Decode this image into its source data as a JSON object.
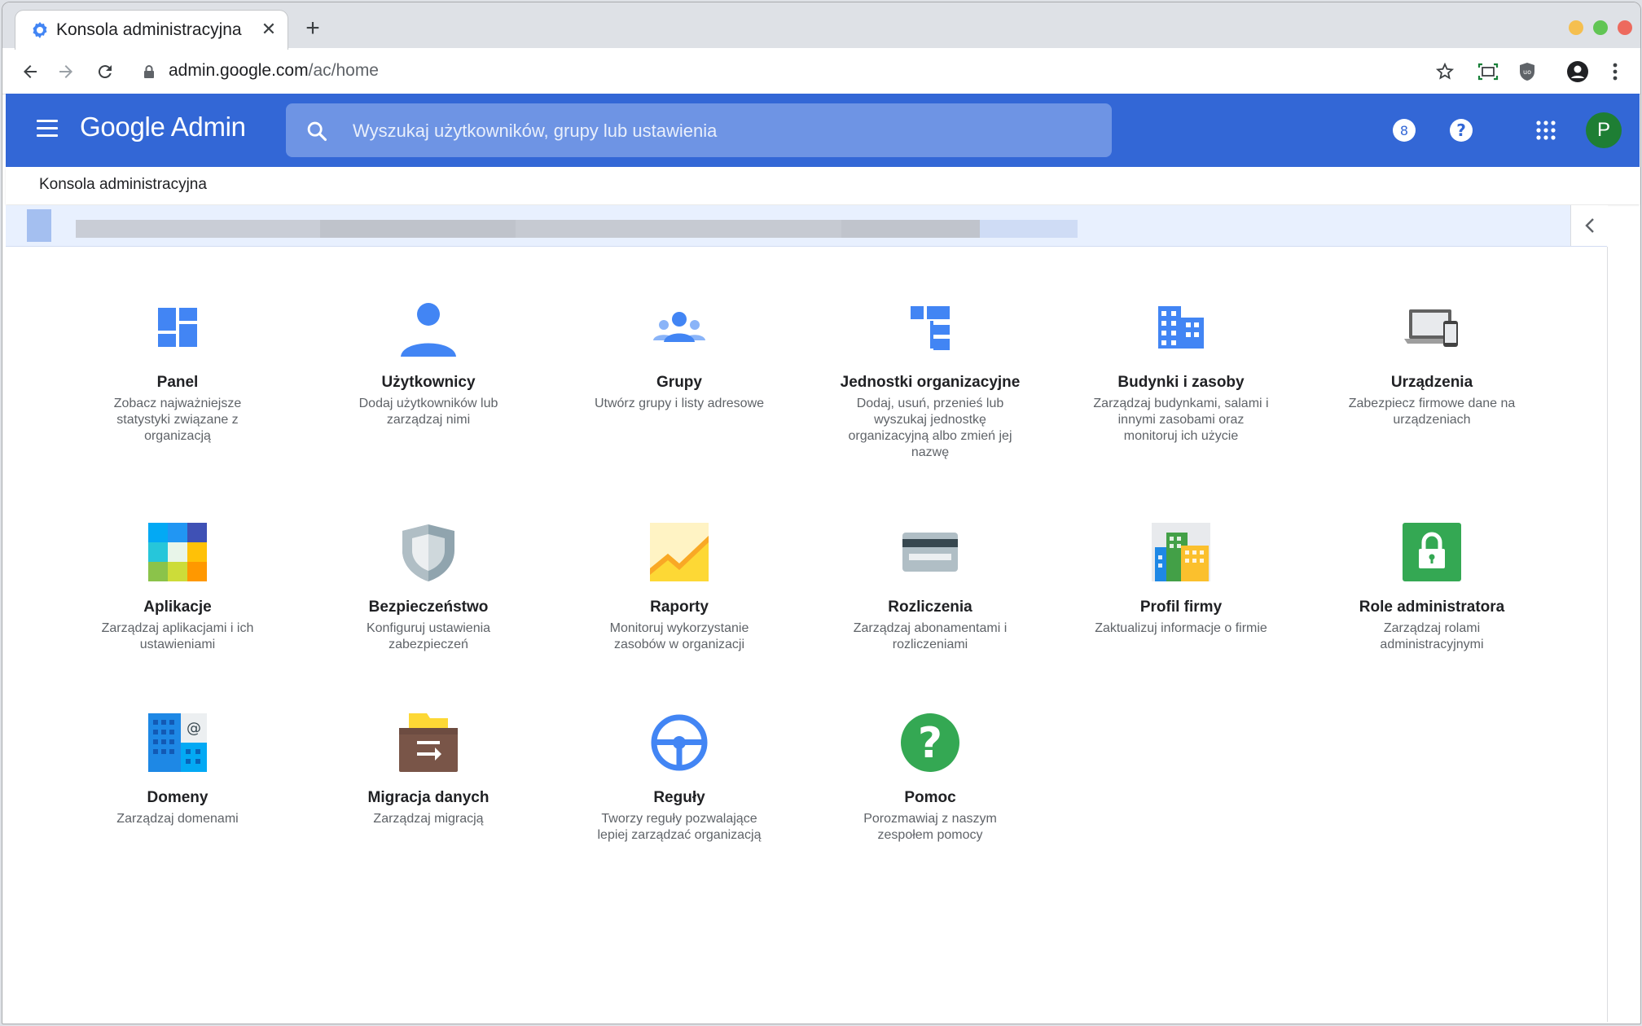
{
  "browser": {
    "tab_title": "Konsola administracyjna",
    "url_host": "admin.google.com",
    "url_path": "/ac/home"
  },
  "header": {
    "brand_google": "Google",
    "brand_admin": "Admin",
    "search_placeholder": "Wyszukaj użytkowników, grupy lub ustawienia",
    "tasks_count": "8",
    "avatar_letter": "P"
  },
  "breadcrumb": {
    "label": "Konsola administracyjna"
  },
  "cards": [
    {
      "title": "Panel",
      "desc": "Zobacz najważniejsze statystyki związane z organizacją",
      "icon": "dashboard-icon"
    },
    {
      "title": "Użytkownicy",
      "desc": "Dodaj użytkowników lub zarządzaj nimi",
      "icon": "user-icon"
    },
    {
      "title": "Grupy",
      "desc": "Utwórz grupy i listy adresowe",
      "icon": "groups-icon"
    },
    {
      "title": "Jednostki organizacyjne",
      "desc": "Dodaj, usuń, przenieś lub wyszukaj jednostkę organizacyjną albo zmień jej nazwę",
      "icon": "org-units-icon"
    },
    {
      "title": "Budynki i zasoby",
      "desc": "Zarządzaj budynkami, salami i innymi zasobami oraz monitoruj ich użycie",
      "icon": "buildings-icon"
    },
    {
      "title": "Urządzenia",
      "desc": "Zabezpiecz firmowe dane na urządzeniach",
      "icon": "devices-icon"
    },
    {
      "title": "Aplikacje",
      "desc": "Zarządzaj aplikacjami i ich ustawieniami",
      "icon": "apps-icon"
    },
    {
      "title": "Bezpieczeństwo",
      "desc": "Konfiguruj ustawienia zabezpieczeń",
      "icon": "security-shield-icon"
    },
    {
      "title": "Raporty",
      "desc": "Monitoruj wykorzystanie zasobów w organizacji",
      "icon": "reports-chart-icon"
    },
    {
      "title": "Rozliczenia",
      "desc": "Zarządzaj abonamentami i rozliczeniami",
      "icon": "billing-card-icon"
    },
    {
      "title": "Profil firmy",
      "desc": "Zaktualizuj informacje o firmie",
      "icon": "company-profile-icon"
    },
    {
      "title": "Role administratora",
      "desc": "Zarządzaj rolami administracyjnymi",
      "icon": "admin-roles-lock-icon"
    },
    {
      "title": "Domeny",
      "desc": "Zarządzaj domenami",
      "icon": "domains-icon"
    },
    {
      "title": "Migracja danych",
      "desc": "Zarządzaj migracją",
      "icon": "data-migration-icon"
    },
    {
      "title": "Reguły",
      "desc": "Tworzy reguły pozwalające lepiej zarządzać organizacją",
      "icon": "rules-steering-icon"
    },
    {
      "title": "Pomoc",
      "desc": "Porozmawiaj z naszym zespołem pomocy",
      "icon": "help-icon"
    }
  ],
  "colors": {
    "appbar": "#3367d6",
    "accent_icon_blue": "#4285f4",
    "avatar_green": "#1e7e34"
  }
}
